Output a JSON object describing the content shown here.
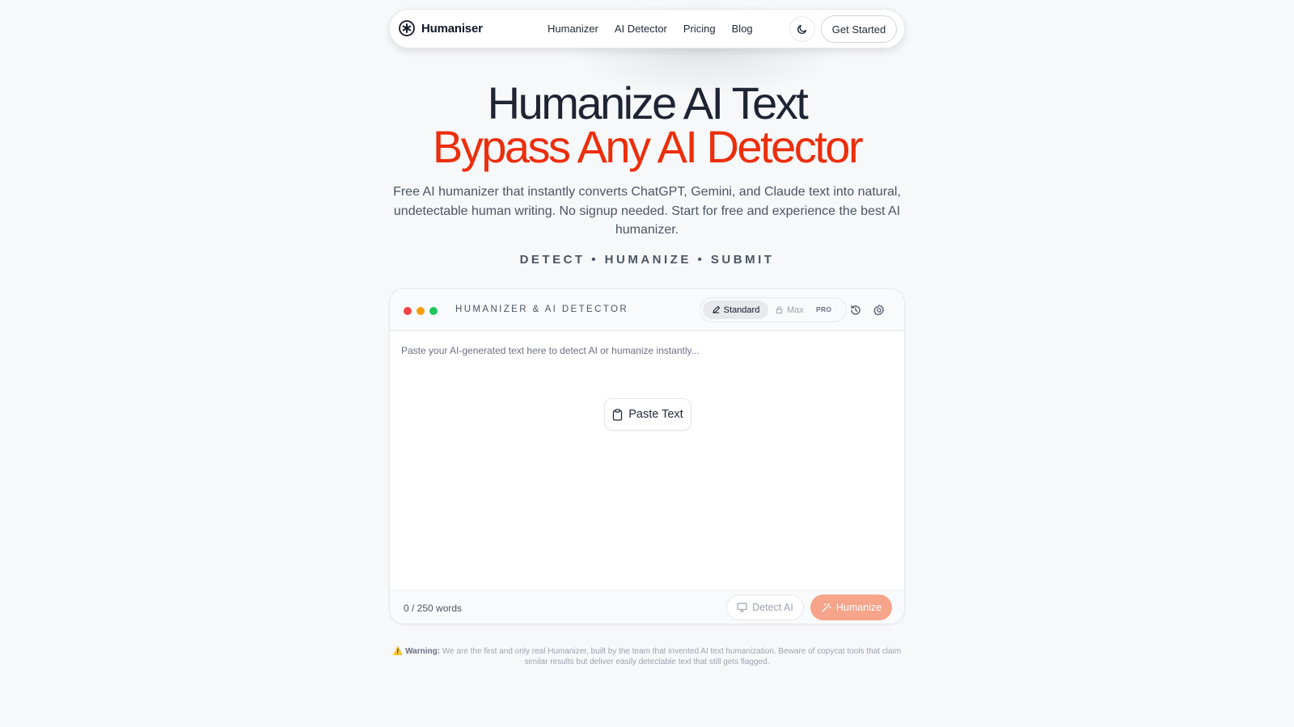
{
  "colors": {
    "accent": "#ec2e0b",
    "humanize_button": "#f6a48a",
    "dot_red": "#ef4444",
    "dot_yellow": "#f59e0b",
    "dot_green": "#22c55e"
  },
  "nav": {
    "brand": "Humaniser",
    "logo_icon": "asterisk-circle-icon",
    "links": [
      "Humanizer",
      "AI Detector",
      "Pricing",
      "Blog"
    ],
    "theme_icon": "moon-icon",
    "cta": "Get Started"
  },
  "hero": {
    "title": "Humanize AI Text",
    "subtitle": "Bypass Any AI Detector",
    "description": "Free AI humanizer that instantly converts ChatGPT, Gemini, and Claude text into natural, undetectable human writing. No signup needed. Start for free and experience the best AI humanizer.",
    "tagline": "DETECT • HUMANIZE • SUBMIT"
  },
  "tool": {
    "title": "HUMANIZER & AI DETECTOR",
    "modes": {
      "standard": "Standard",
      "standard_icon": "pencil-icon",
      "max": "Max",
      "max_icon": "lock-icon",
      "pro_badge": "PRO"
    },
    "history_icon": "history-icon",
    "settings_icon": "gear-icon",
    "input_placeholder": "Paste your AI-generated text here to detect AI or humanize instantly...",
    "paste_button": "Paste Text",
    "paste_icon": "clipboard-icon",
    "word_count": "0 / 250 words",
    "detect_button": "Detect AI",
    "detect_icon": "monitor-icon",
    "humanize_button": "Humanize",
    "humanize_icon": "magic-wand-icon"
  },
  "warning": {
    "icon": "⚠️",
    "label": "Warning:",
    "text": "We are the first and only real Humanizer, built by the team that invented AI text humanization. Beware of copycat tools that claim similar results but deliver easily detectable text that still gets flagged."
  }
}
